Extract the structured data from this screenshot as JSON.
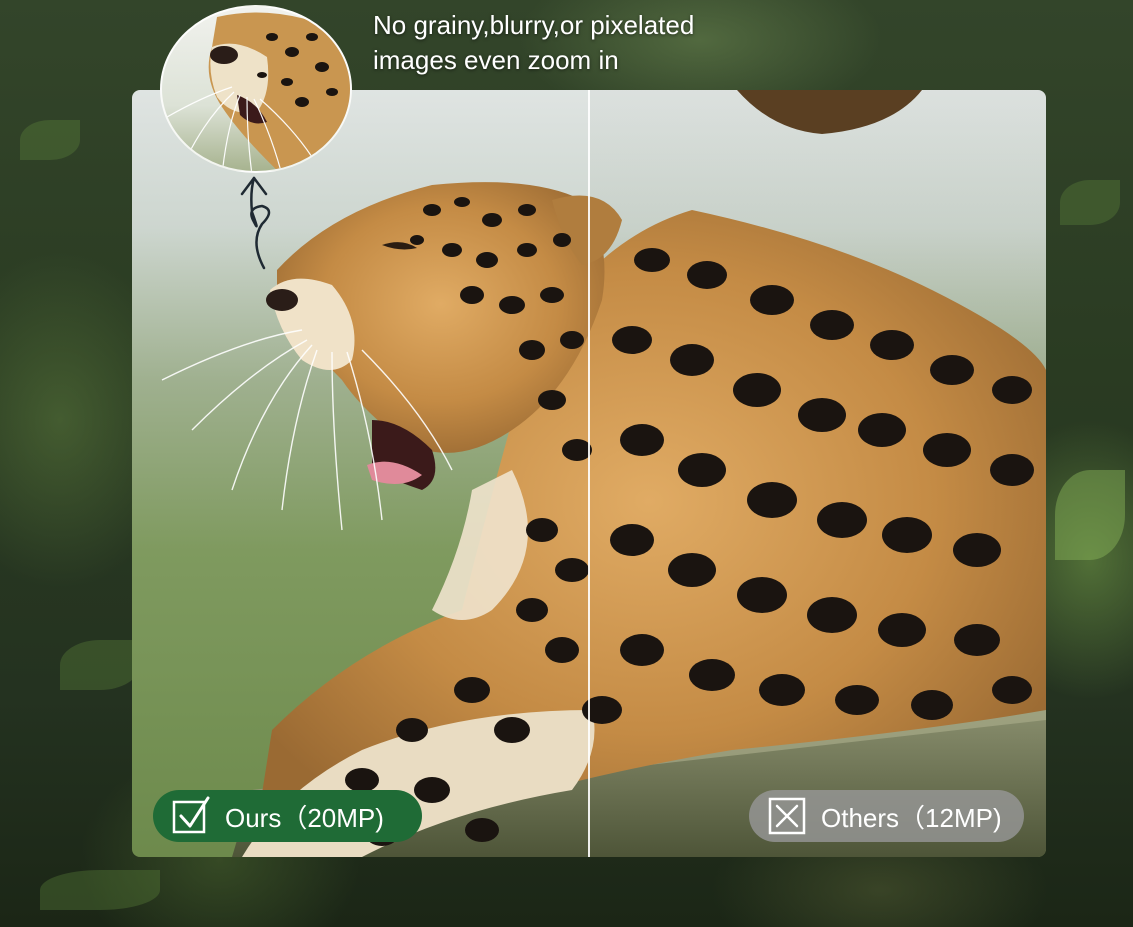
{
  "headline": {
    "line1": "No grainy,blurry,or pixelated",
    "line2": "images even zoom in"
  },
  "badges": {
    "ours": {
      "label": "Ours（20MP)",
      "icon": "checked-box-icon",
      "color": "#1f6b36"
    },
    "others": {
      "label": "Others（12MP)",
      "icon": "x-box-icon",
      "color": "#969696"
    }
  },
  "icons": {
    "zoom": "zoom-magnifier-circle",
    "arrow": "curly-up-arrow-icon"
  },
  "colors": {
    "leopard_coat": "#c7904a",
    "leopard_spot": "#1a1410",
    "background_green": "#2a3b22"
  }
}
